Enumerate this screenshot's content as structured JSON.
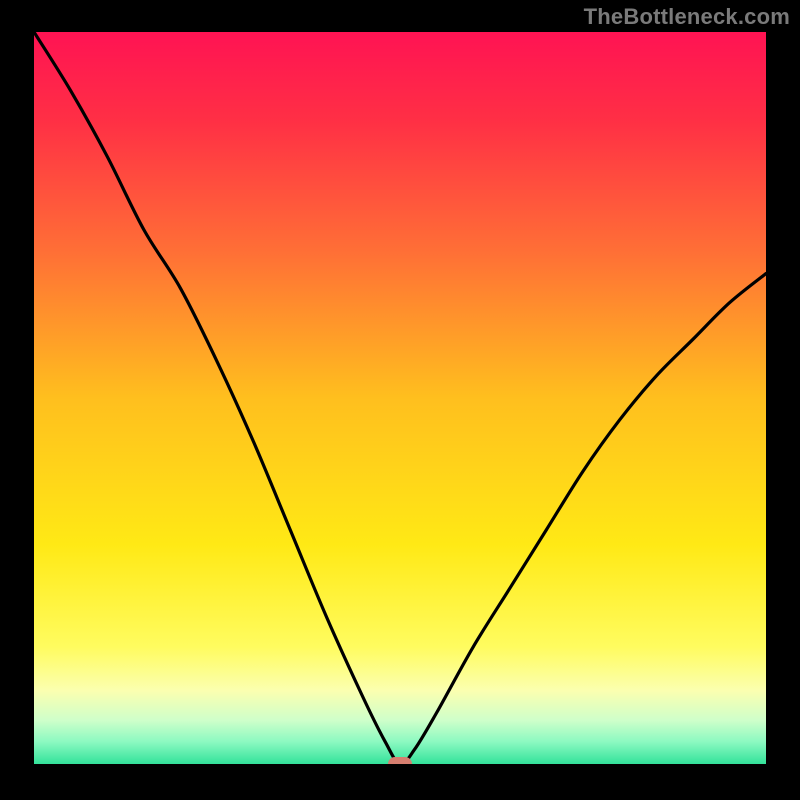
{
  "watermark": "TheBottleneck.com",
  "chart_data": {
    "type": "line",
    "title": "",
    "xlabel": "",
    "ylabel": "",
    "xlim": [
      0,
      100
    ],
    "ylim": [
      0,
      100
    ],
    "grid": false,
    "legend": false,
    "background_gradient_stops": [
      {
        "pos": 0.0,
        "color": "#ff1353"
      },
      {
        "pos": 0.12,
        "color": "#ff2f45"
      },
      {
        "pos": 0.3,
        "color": "#ff6f36"
      },
      {
        "pos": 0.5,
        "color": "#ffbf1e"
      },
      {
        "pos": 0.7,
        "color": "#ffe915"
      },
      {
        "pos": 0.84,
        "color": "#fffc5f"
      },
      {
        "pos": 0.9,
        "color": "#fbffb0"
      },
      {
        "pos": 0.94,
        "color": "#cfffca"
      },
      {
        "pos": 0.97,
        "color": "#8bf9c1"
      },
      {
        "pos": 1.0,
        "color": "#33e29a"
      }
    ],
    "series": [
      {
        "name": "bottleneck-curve",
        "color": "#000000",
        "x": [
          0,
          5,
          10,
          15,
          20,
          25,
          30,
          35,
          40,
          45,
          48,
          50,
          52,
          55,
          60,
          65,
          70,
          75,
          80,
          85,
          90,
          95,
          100
        ],
        "y": [
          100,
          92,
          83,
          73,
          65,
          55,
          44,
          32,
          20,
          9,
          3,
          0,
          2,
          7,
          16,
          24,
          32,
          40,
          47,
          53,
          58,
          63,
          67
        ]
      }
    ],
    "marker": {
      "x": 50,
      "y": 0,
      "color": "#d67e6f"
    }
  }
}
